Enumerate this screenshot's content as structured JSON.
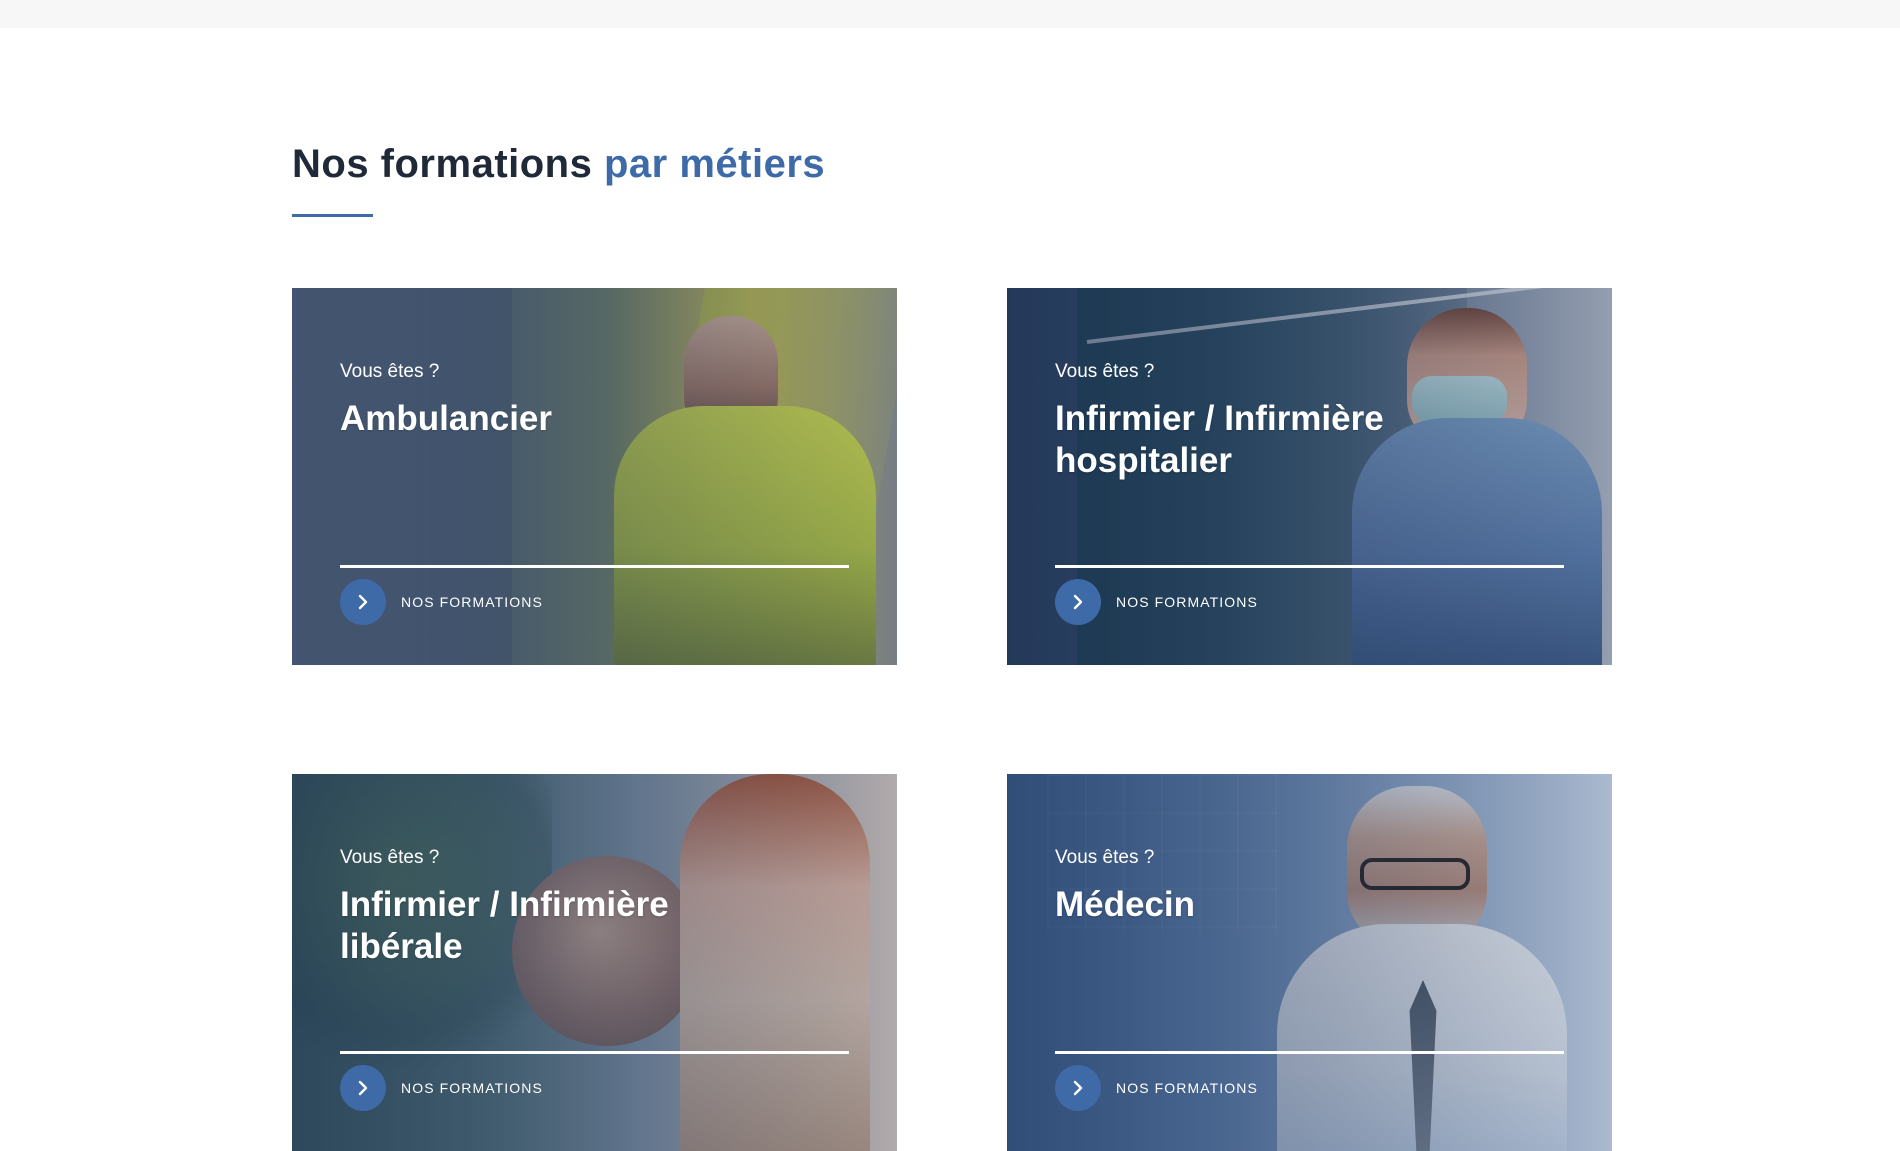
{
  "section": {
    "title_main": "Nos formations",
    "title_accent": "par métiers"
  },
  "cards": [
    {
      "eyebrow": "Vous êtes ?",
      "title": "Ambulancier",
      "cta": "NOS FORMATIONS"
    },
    {
      "eyebrow": "Vous êtes ?",
      "title": "Infirmier / Infirmière hospitalier",
      "cta": "NOS FORMATIONS"
    },
    {
      "eyebrow": "Vous êtes ?",
      "title": "Infirmier / Infirmière libérale",
      "cta": "NOS FORMATIONS"
    },
    {
      "eyebrow": "Vous êtes ?",
      "title": "Médecin",
      "cta": "NOS FORMATIONS"
    }
  ],
  "colors": {
    "accent": "#3f6aa8",
    "title": "#1f2937",
    "overlay": "#1a2f54",
    "white": "#ffffff"
  },
  "icons": {
    "card_arrow": "chevron-right-icon"
  }
}
